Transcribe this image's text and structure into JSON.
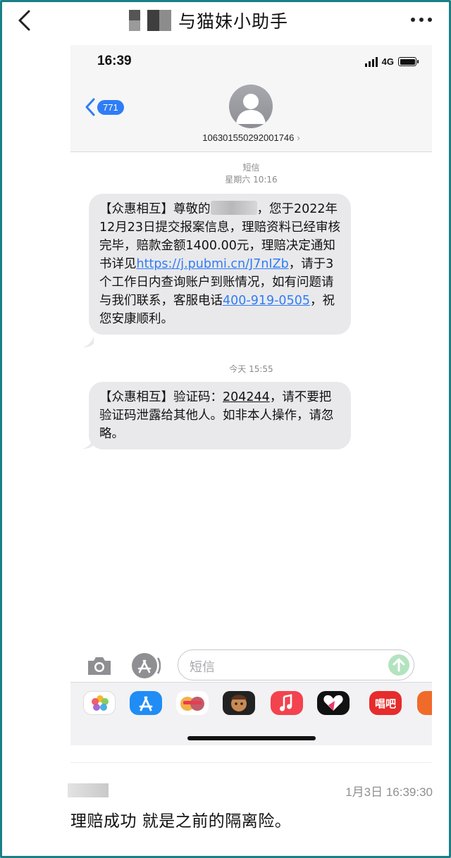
{
  "app": {
    "title": "与猫妹小助手",
    "accent": "#1a7f86"
  },
  "phone": {
    "status": {
      "time": "16:39",
      "network": "4G"
    },
    "conversation": {
      "back_count": "771",
      "sender_number": "106301550292001746",
      "sender_chevron": "›"
    },
    "messages": [
      {
        "channel": "短信",
        "timestamp": "星期六 10:16",
        "segments": {
          "a": "【众惠相互】尊敬的",
          "b": "，您于2022年12月23日提交报案信息，理赔资料已经审核完毕，赔款金额1400.00元，理赔决定通知书详见",
          "link": "https://j.pubmi.cn/J7nIZb",
          "c": "，请于3个工作日内查询账户到账情况，如有问题请与我们联系，客服电话",
          "phone": "400-919-0505",
          "d": "，祝您安康顺利。"
        }
      },
      {
        "timestamp": "今天 15:55",
        "segments": {
          "a": "【众惠相互】验证码：",
          "code": "204244",
          "b": "，请不要把验证码泄露给其他人。如非本人操作，请忽略。"
        }
      }
    ],
    "input": {
      "placeholder": "短信"
    },
    "app_drawer": {
      "items": [
        "photos-app",
        "app-store-app",
        "memoji-stickers",
        "animoji",
        "music-app",
        "digital-touch",
        "changba-app",
        "partial-app"
      ],
      "changba_label": "唱吧"
    }
  },
  "comment": {
    "time": "1月3日 16:39:30",
    "text": "理赔成功 就是之前的隔离险。"
  }
}
